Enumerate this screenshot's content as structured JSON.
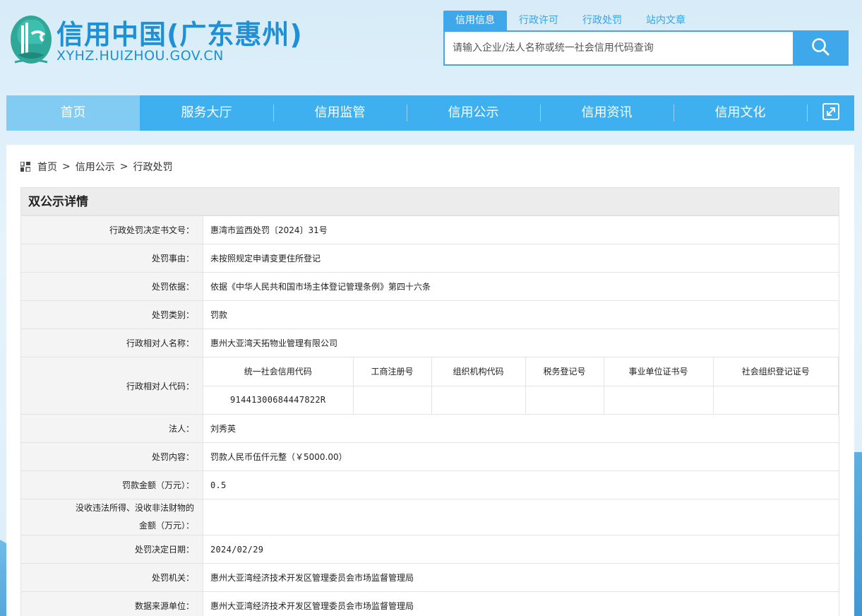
{
  "header": {
    "title": "信用中国(广东惠州)",
    "subtitle": "XYHZ.HUIZHOU.GOV.CN",
    "logo_icon": "logo-icon"
  },
  "search": {
    "tabs": [
      "信用信息",
      "行政许可",
      "行政处罚",
      "站内文章"
    ],
    "active_tab": "信用信息",
    "placeholder": "请输入企业/法人名称或统一社会信用代码查询",
    "value": "",
    "button_icon": "search-icon"
  },
  "nav": {
    "items": [
      "首页",
      "服务大厅",
      "信用监管",
      "信用公示",
      "信用资讯",
      "信用文化"
    ],
    "active": "首页",
    "expand_icon": "expand-icon"
  },
  "breadcrumb": {
    "icon": "grid-icon",
    "items": [
      "首页",
      "信用公示",
      "行政处罚"
    ],
    "separator": ">"
  },
  "detail": {
    "title": "双公示详情",
    "rows": {
      "decision_no": {
        "label": "行政处罚决定书文号：",
        "value": "惠湾市监西处罚〔2024〕31号"
      },
      "reason": {
        "label": "处罚事由：",
        "value": "未按照规定申请变更住所登记"
      },
      "basis": {
        "label": "处罚依据：",
        "value": "依据《中华人民共和国市场主体登记管理条例》第四十六条"
      },
      "category": {
        "label": "处罚类别：",
        "value": "罚款"
      },
      "party_name": {
        "label": "行政相对人名称：",
        "value": "惠州大亚湾天拓物业管理有限公司"
      },
      "party_code": {
        "label": "行政相对人代码："
      },
      "legal_person": {
        "label": "法人：",
        "value": "刘秀英"
      },
      "content": {
        "label": "处罚内容：",
        "value": "罚款人民币伍仟元整（￥5000.00）"
      },
      "fine_amount": {
        "label": "罚款金额（万元）：",
        "value": "0.5"
      },
      "confiscation": {
        "label_line1": "没收违法所得、没收非法财物的",
        "label_line2": "金额（万元）：",
        "value": ""
      },
      "decision_date": {
        "label": "处罚决定日期：",
        "value": "2024/02/29"
      },
      "authority": {
        "label": "处罚机关：",
        "value": "惠州大亚湾经济技术开发区管理委员会市场监督管理局"
      },
      "source": {
        "label": "数据来源单位：",
        "value": "惠州大亚湾经济技术开发区管理委员会市场监督管理局"
      }
    },
    "codes": {
      "headers": [
        "统一社会信用代码",
        "工商注册号",
        "组织机构代码",
        "税务登记号",
        "事业单位证书号",
        "社会组织登记证号"
      ],
      "values": [
        "91441300684447822R",
        "",
        "",
        "",
        "",
        ""
      ]
    }
  },
  "colors": {
    "brand": "#3fb0ef",
    "nav_active": "#82ccf4",
    "logo_text": "#1f8fd6",
    "label_bg": "#f4f4f4"
  }
}
